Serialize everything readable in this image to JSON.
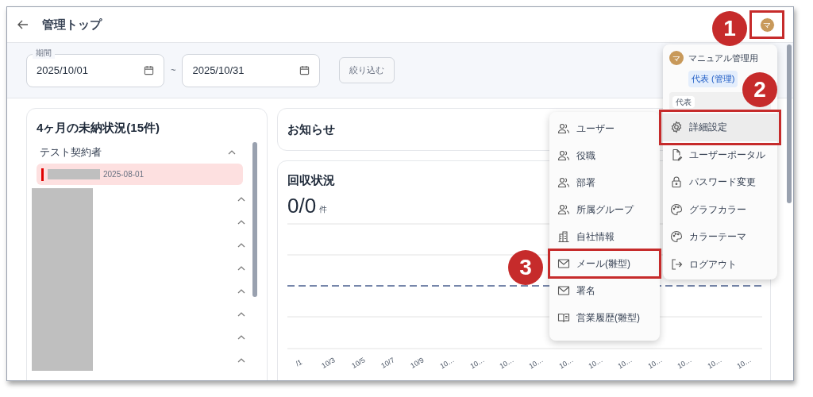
{
  "header": {
    "title": "管理トップ",
    "avatar": "マ"
  },
  "filter": {
    "period_label": "期間",
    "start_date": "2025/10/01",
    "separator": "~",
    "end_date": "2025/10/31",
    "button": "絞り込む"
  },
  "unpaid_card": {
    "title": "4ヶ月の未納状況(15件)",
    "groups": [
      {
        "name": "テスト契約者",
        "expanded": true,
        "items": [
          {
            "date": "2025-08-01"
          }
        ]
      }
    ],
    "more_groups": [
      {
        "expanded": true
      },
      {
        "expanded": true
      },
      {
        "expanded": true
      },
      {
        "expanded": true
      },
      {
        "expanded": true
      },
      {
        "expanded": true
      },
      {
        "expanded": true
      },
      {
        "expanded": true
      }
    ]
  },
  "notice_card": {
    "title": "お知らせ"
  },
  "collection_card": {
    "title": "回収状況",
    "count": "0/0",
    "unit": "件",
    "x_labels": [
      "/1",
      "10/3",
      "10/5",
      "10/7",
      "10/9",
      "10…",
      "10…",
      "10…",
      "10…",
      "10…",
      "10…",
      "10…",
      "10…",
      "10…",
      "10…",
      "10…"
    ]
  },
  "user_menu": {
    "avatar": "マ",
    "name": "マニュアル管理用",
    "role_chip": "代表 (管理)",
    "role_select": "代表",
    "items": [
      {
        "kind": "settings",
        "label": "詳細設定",
        "selected": true,
        "highlighted": true
      },
      {
        "kind": "file",
        "label": "ユーザーポータル",
        "selected": false,
        "highlighted": false
      },
      {
        "kind": "lock",
        "label": "パスワード変更",
        "selected": false,
        "highlighted": false
      },
      {
        "kind": "palette",
        "label": "グラフカラー",
        "selected": false,
        "highlighted": false
      },
      {
        "kind": "palette",
        "label": "カラーテーマ",
        "selected": false,
        "highlighted": false
      },
      {
        "kind": "logout",
        "label": "ログアウト",
        "selected": false,
        "highlighted": false
      }
    ]
  },
  "settings_submenu": {
    "items": [
      {
        "kind": "people",
        "label": "ユーザー",
        "highlighted": false
      },
      {
        "kind": "people",
        "label": "役職",
        "highlighted": false
      },
      {
        "kind": "people",
        "label": "部署",
        "highlighted": false
      },
      {
        "kind": "people",
        "label": "所属グループ",
        "highlighted": false
      },
      {
        "kind": "building",
        "label": "自社情報",
        "highlighted": false
      },
      {
        "kind": "mail",
        "label": "メール(雛型)",
        "highlighted": true
      },
      {
        "kind": "mail",
        "label": "署名",
        "highlighted": false
      },
      {
        "kind": "book",
        "label": "営業履歴(雛型)",
        "highlighted": false
      }
    ]
  },
  "annotations": [
    {
      "number": "1"
    },
    {
      "number": "2"
    },
    {
      "number": "3"
    }
  ]
}
